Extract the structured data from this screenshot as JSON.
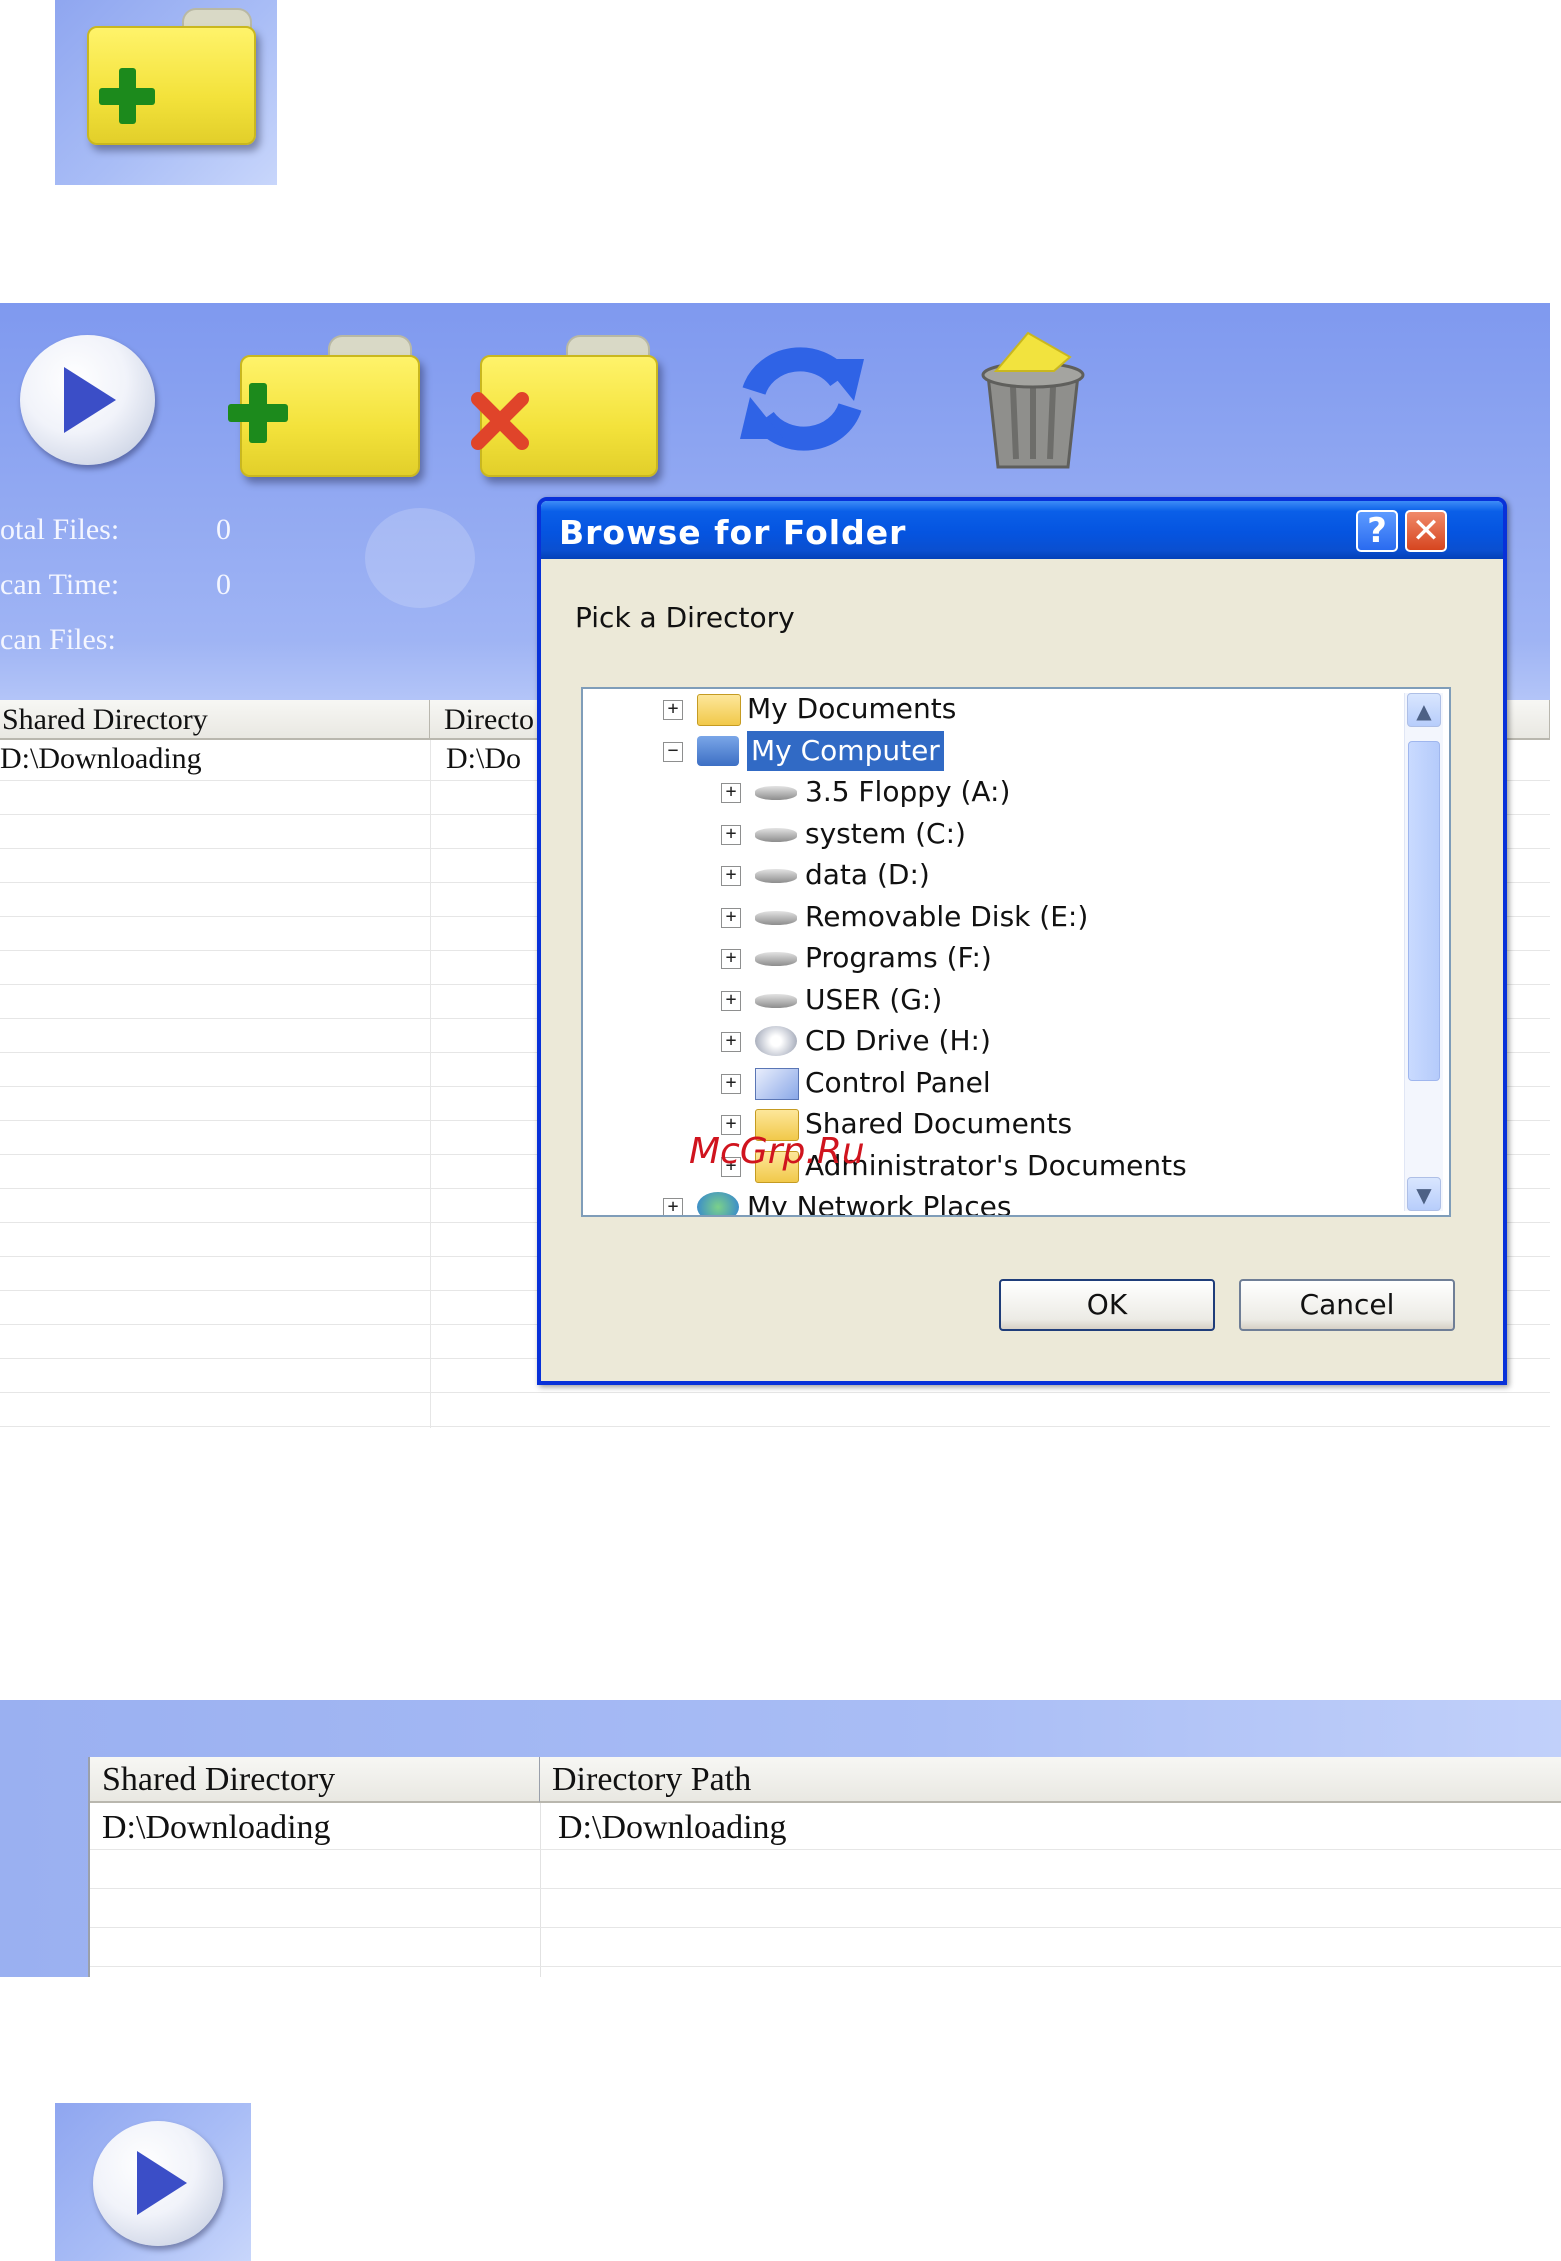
{
  "app": {
    "stats": [
      {
        "label": "otal Files:",
        "value": "0"
      },
      {
        "label": "can Time:",
        "value": "0"
      },
      {
        "label": "can Files:",
        "value": ""
      }
    ],
    "toolbar": [
      "play-icon",
      "add-folder-icon",
      "remove-folder-icon",
      "refresh-icon",
      "recycle-bin-icon"
    ],
    "table": {
      "headers": [
        "Shared Directory",
        "Directo"
      ],
      "rows": [
        [
          "D:\\Downloading",
          "D:\\Do"
        ]
      ]
    }
  },
  "dialog": {
    "title": "Browse for Folder",
    "help_label": "?",
    "close_label": "✕",
    "prompt": "Pick a Directory",
    "tree": [
      {
        "label": "My Documents",
        "expander": "+"
      },
      {
        "label": "My Computer",
        "expander": "−",
        "selected": true
      },
      {
        "label": "3.5 Floppy (A:)",
        "expander": "+"
      },
      {
        "label": "system (C:)",
        "expander": "+"
      },
      {
        "label": "data (D:)",
        "expander": "+"
      },
      {
        "label": "Removable Disk (E:)",
        "expander": "+"
      },
      {
        "label": "Programs (F:)",
        "expander": "+"
      },
      {
        "label": "USER (G:)",
        "expander": "+"
      },
      {
        "label": "CD Drive (H:)",
        "expander": "+"
      },
      {
        "label": "Control Panel",
        "expander": "+"
      },
      {
        "label": "Shared Documents",
        "expander": "+"
      },
      {
        "label": "Administrator's Documents",
        "expander": "+"
      },
      {
        "label": "My Network Places",
        "expander": "+"
      }
    ],
    "ok_label": "OK",
    "cancel_label": "Cancel",
    "watermark": "McGrp.Ru"
  },
  "panel2": {
    "headers": [
      "Shared Directory",
      "Directory Path"
    ],
    "rows": [
      [
        "D:\\Downloading",
        "D:\\Downloading"
      ]
    ]
  },
  "colors": {
    "title_bar": "#0554e0",
    "selection": "#316ac5",
    "window_gradient": "#8fa6f0",
    "folder_yellow": "#f3e23b",
    "plus_green": "#1c8a1c",
    "cross_red": "#e0442a"
  }
}
